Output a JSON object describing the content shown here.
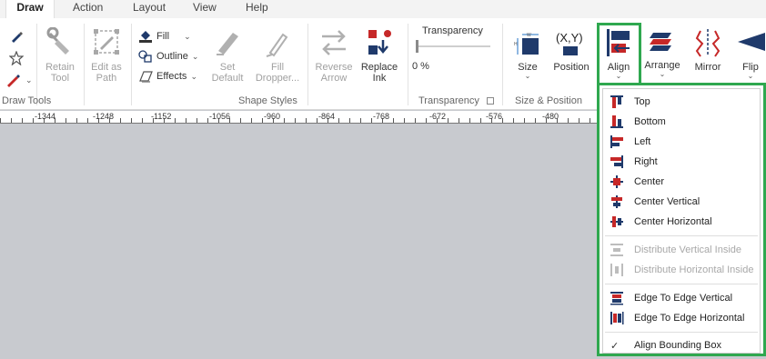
{
  "tabs": [
    "Draw",
    "Action",
    "Layout",
    "View",
    "Help"
  ],
  "groups": {
    "draw_tools": "Draw Tools",
    "shape_styles": "Shape Styles",
    "transparency": "Transparency",
    "size_position": "Size & Position"
  },
  "buttons": {
    "retain_tool": [
      "Retain",
      "Tool"
    ],
    "edit_as_path": [
      "Edit as",
      "Path"
    ],
    "set_default": [
      "Set",
      "Default"
    ],
    "fill_dropper": [
      "Fill",
      "Dropper..."
    ],
    "reverse_arrow": [
      "Reverse",
      "Arrow"
    ],
    "replace_ink": [
      "Replace",
      "Ink"
    ],
    "size": "Size",
    "position": "Position",
    "align": "Align",
    "arrange": "Arrange",
    "mirror": "Mirror",
    "flip": "Flip"
  },
  "style_rows": [
    "Fill",
    "Outline",
    "Effects"
  ],
  "transparency": {
    "title": "Transparency",
    "value": "0 %",
    "level": 0
  },
  "ruler": [
    "-1344",
    "-1248",
    "-1152",
    "-1056",
    "-960",
    "-864",
    "-768",
    "-672",
    "-576",
    "-480"
  ],
  "align_menu": {
    "group1": [
      "Top",
      "Bottom",
      "Left",
      "Right",
      "Center",
      "Center Vertical",
      "Center Horizontal"
    ],
    "group2": [
      "Distribute Vertical Inside",
      "Distribute Horizontal Inside"
    ],
    "group3": [
      "Edge To Edge Vertical",
      "Edge To Edge Horizontal"
    ],
    "group4": [
      "Align Bounding Box"
    ],
    "checkmark": "✓"
  },
  "colors": {
    "highlight": "#2fa84f",
    "accent_red": "#c62828",
    "accent_navy": "#1f3a6b"
  }
}
